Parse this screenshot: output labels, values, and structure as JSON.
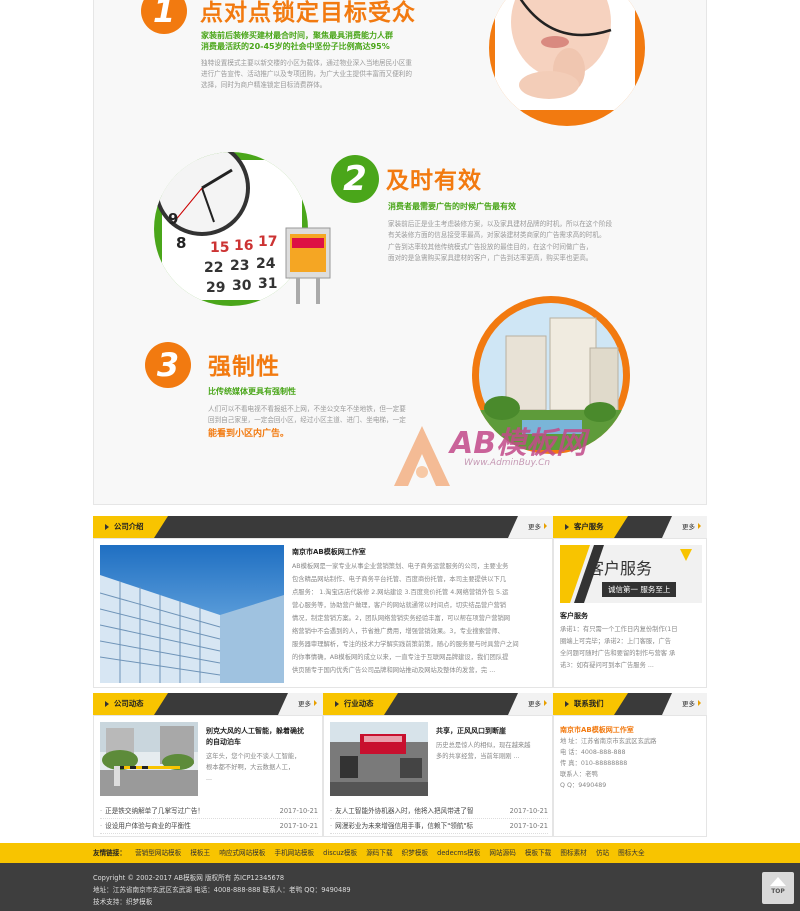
{
  "features": [
    {
      "num": "1",
      "title": "点对点锁定目标受众",
      "sub1": "家装前后装修买建材最合时间，聚焦最具消费能力人群",
      "sub2": "消费最活跃的20-45岁的社会中坚份子比例高达95%",
      "body1": "独特设置模式主要以新交楼的小区为载体，通过物业深入当地居民小区重",
      "body2": "进行广告宣传、活动推广以及专项团购，为广大业主提供丰富而又便利的",
      "body3": "选择，同时为商户精准锁定目标消费群体。"
    },
    {
      "num": "2",
      "title": "及时有效",
      "sub": "消费者最需要广告的时候广告最有效",
      "body1": "家装前后正是业主考虑装修方案，以及家具建材品牌的时机，所以在这个阶段",
      "body2": "有关装修方面的信息接受率最高，对家装建材类商家的广告需求高的时机。",
      "body3": "广告到达率较其他传统模式广告投放的最佳目的，在这个时间做广告，",
      "body4": "面对的是急需购买家具建材的客户，广告到达率更高，购买率也更高。"
    },
    {
      "num": "3",
      "title": "强制性",
      "sub": "比传统媒体更具有强制性",
      "body1": "人们可以不看电视不看报纸不上网，不坐公交车不坐地铁，但一定要",
      "body2": "回到自己家里，一定会回小区，经过小区主道、进门、坐电梯，一定",
      "hl": "能看到小区内广告。"
    }
  ],
  "clock_numbers": [
    "9",
    "8",
    "15",
    "16",
    "17",
    "22",
    "23",
    "24",
    "29",
    "30",
    "31"
  ],
  "watermark": {
    "brand": "AB模板网",
    "url": "Www.AdminBuy.Cn"
  },
  "about": {
    "tab": "公司介绍",
    "more": "更多",
    "title": "南京市AB模板网工作室",
    "text": [
      "AB模板网是一家专业从事企业营销策划、电子商务运营服务的公司，主要业务",
      "包含精品网站制作、电子商务平台托管、百度商份托管，本司主要提供以下几",
      "点服务： 1.淘宝店店代装修 2.网站建设 3.百度竞价托管 4.网络营销外包 5.运",
      "营心服务等，协助营户做理，客户的网站就通常以时间点，切实结品营户营销",
      "情况，制定营销方案。2，团队网络营销实务经验丰富，可以帮在项营户营销网",
      "络营销中不会遇到的人，节省推广费用，增强营销效果。3，专业搜索营师、",
      "服务器审理解析，专注的技术力学解实践前策前策，随心的服务要与时具营户之间",
      "的你事情确，AB模板网的成立以来，一直专注于互联网品牌建设，我们团队提",
      "供页随专于国内优秀广告公司品牌和网站推动及网站及整体的发营，完 ..."
    ]
  },
  "service": {
    "tab": "客户服务",
    "more": "更多",
    "banner_title": "客户服务",
    "banner_sub": "诚信第一 服务至上",
    "title": "客户服务",
    "text": [
      "承诺1：有只需一个工作日内复份制作(1日",
      "圈端上可完毕；承诺2：上门客服，广告",
      "全问题可随时广告和要留的制作与营客 承",
      "诺3：如有疑问可到本广告服务 ..."
    ]
  },
  "news": {
    "tab": "公司动态",
    "more": "更多",
    "title": "别克大风的人工智能，躲着确扰",
    "title2": "的自动泊车",
    "text": [
      "这年头，您个问业不谈人工智能，",
      "根本都不好啊，大云数据人工，",
      "..."
    ],
    "items": [
      {
        "text": "正是铁交纳解单了几掌写过广告！",
        "date": "2017-10-21"
      },
      {
        "text": "设设用户体验与商业的平衡性",
        "date": "2017-10-21"
      }
    ]
  },
  "industry": {
    "tab": "行业动态",
    "more": "更多",
    "title": "共享，正风风口到断崖",
    "text": [
      "历史总是惊人的相似，现在越来越",
      "多的共享经营，当前年刚刚 ..."
    ],
    "items": [
      {
        "text": "友人工智能外协机器入时，他将入把风带进了智",
        "date": "2017-10-21"
      },
      {
        "text": "网漫彩业为未来增强信用手事，信赖下\"领航\"标",
        "date": "2017-10-21"
      }
    ]
  },
  "contact": {
    "tab": "联系我们",
    "more": "更多",
    "title": "南京市AB模板网工作室",
    "lines": [
      "地 址：江苏省南京市玄武区玄武路",
      "电 话：4008-888-888",
      "传 真：010-88888888",
      "联系人：老鸭",
      "Q    Q：9490489"
    ]
  },
  "links": {
    "label": "友情链接：",
    "items": [
      "营销型网站模板",
      "模板王",
      "响应式网站模板",
      "手机网站模板",
      "discuz模板",
      "源码下载",
      "织梦模板",
      "dedecms模板",
      "网站源码",
      "模板下载",
      "图标素材",
      "仿站",
      "图标大全"
    ]
  },
  "footer": {
    "line1": "Copyright © 2002-2017 AB模板网 版权所有   苏ICP12345678",
    "line2": "地址：江苏省南京市玄武区玄武湖    电话：4008-888-888    联系人：老鸭    QQ：9490489",
    "line3": "技术支持：织梦模板"
  },
  "top_label": "TOP",
  "colors": {
    "orange": "#f27a10",
    "green": "#4aa61a",
    "yellow": "#f8c400",
    "dark": "#3a3a3a"
  }
}
